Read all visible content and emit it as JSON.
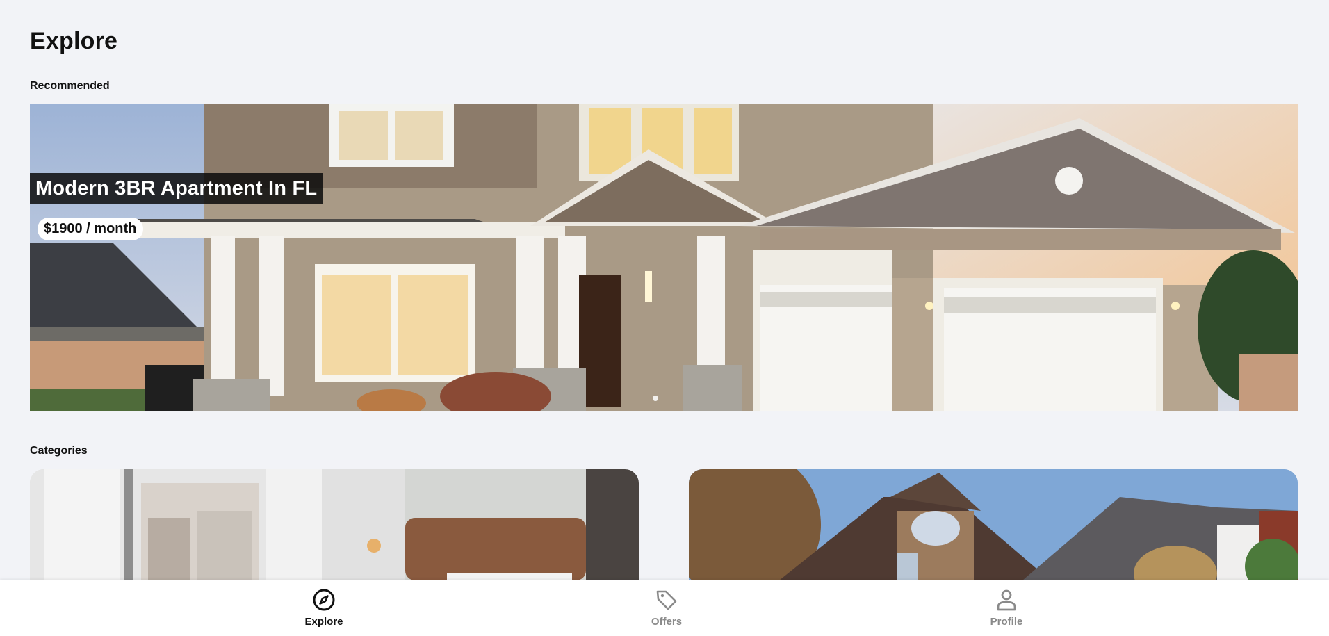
{
  "page": {
    "title": "Explore"
  },
  "sections": {
    "recommended": "Recommended",
    "categories": "Categories"
  },
  "featured": {
    "title": "Modern 3BR Apartment In FL",
    "price": "$1900 / month"
  },
  "categories": [
    {
      "id": "apartment",
      "image": "bedroom-photo"
    },
    {
      "id": "house",
      "image": "house-photo"
    }
  ],
  "nav": {
    "active": "explore",
    "items": [
      {
        "id": "explore",
        "label": "Explore",
        "icon": "compass-icon"
      },
      {
        "id": "offers",
        "label": "Offers",
        "icon": "tag-icon"
      },
      {
        "id": "profile",
        "label": "Profile",
        "icon": "person-icon"
      }
    ]
  },
  "colors": {
    "background": "#f2f3f7",
    "nav_active": "#111111",
    "nav_inactive": "#8a8a8a"
  }
}
